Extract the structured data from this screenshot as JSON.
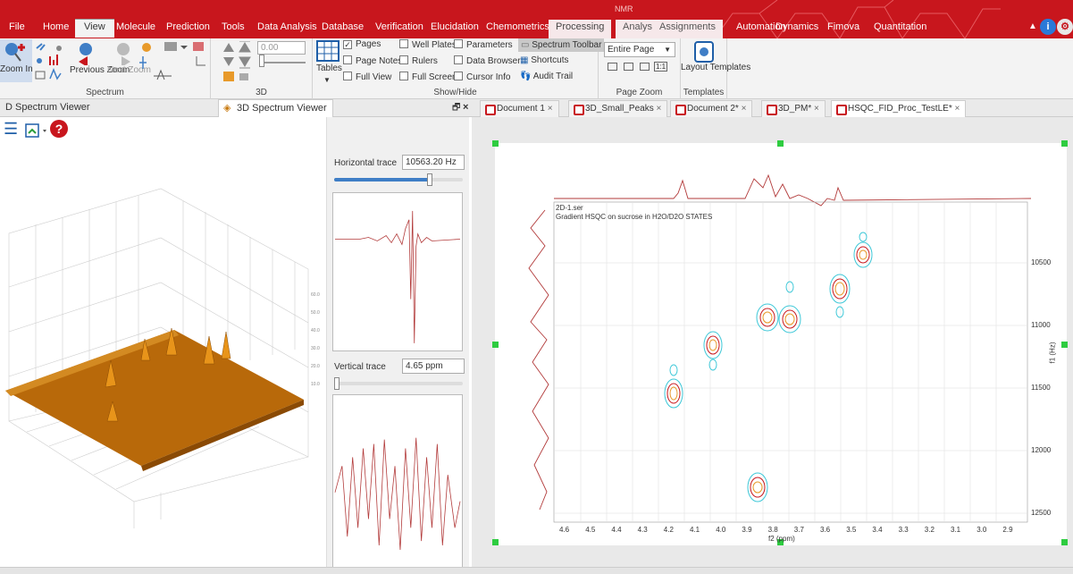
{
  "menu_tabs": [
    "File",
    "Home",
    "View",
    "Molecule",
    "Prediction",
    "Tools",
    "Data Analysis",
    "Database",
    "Verification",
    "Elucidation",
    "Chemometrics",
    "Processing",
    "Analysis",
    "Assignments",
    "Automation",
    "Dynamics",
    "Fimova",
    "Quantitation"
  ],
  "context_label": "NMR",
  "ribbon": {
    "spectrum": {
      "zoom_in": "Zoom In",
      "previous_zoom": "Previous Zoom",
      "next_zoom": "Next Zoom",
      "label": "Spectrum"
    },
    "three_d": {
      "value": "0.00",
      "label": "3D"
    },
    "showhide": {
      "tables": "Tables",
      "pages": "Pages",
      "page_notes": "Page Notes",
      "full_view": "Full View",
      "well_plates": "Well Plates",
      "rulers": "Rulers",
      "full_screen": "Full Screen",
      "parameters": "Parameters",
      "data_browser": "Data Browser",
      "cursor_info": "Cursor Info",
      "spectrum_toolbar": "Spectrum Toolbar",
      "shortcuts": "Shortcuts",
      "audit_trail": "Audit Trail",
      "label": "Show/Hide"
    },
    "page_zoom": {
      "select": "Entire Page",
      "one_to_one": "1:1",
      "label": "Page Zoom"
    },
    "templates": {
      "layout_templates": "Layout Templates",
      "label": "Templates"
    }
  },
  "panes": {
    "left_title": "D Spectrum Viewer",
    "mid_title": "3D Spectrum Viewer",
    "float_icon": "pin-icon",
    "close_icon": "close-icon"
  },
  "doc_tabs": [
    "Document 1",
    "3D_Small_Peaks",
    "Document 2*",
    "3D_PM*",
    "HSQC_FID_Proc_TestLE*"
  ],
  "traces": {
    "horizontal_label": "Horizontal trace",
    "horizontal_value": "10563.20 Hz",
    "horizontal_slider": 0.74,
    "vertical_label": "Vertical trace",
    "vertical_value": "4.65 ppm",
    "vertical_slider": 0.0
  },
  "spectrum": {
    "filename": "2D-1.ser",
    "description": "Gradient HSQC on sucrose in H2O/D2O STATES",
    "x_ticks": [
      "4.6",
      "4.5",
      "4.4",
      "4.3",
      "4.2",
      "4.1",
      "4.0",
      "3.9",
      "3.8",
      "3.7",
      "3.6",
      "3.5",
      "3.4",
      "3.3",
      "3.2",
      "3.1",
      "3.0",
      "2.9"
    ],
    "x_label": "f2 (ppm)",
    "y_ticks": [
      "10500",
      "11000",
      "11500",
      "12000",
      "12500"
    ],
    "y_label": "f1 (Hz)"
  },
  "colors": {
    "brand": "#c8161d",
    "surface": "#c87a10",
    "trace": "#b23a3a"
  }
}
